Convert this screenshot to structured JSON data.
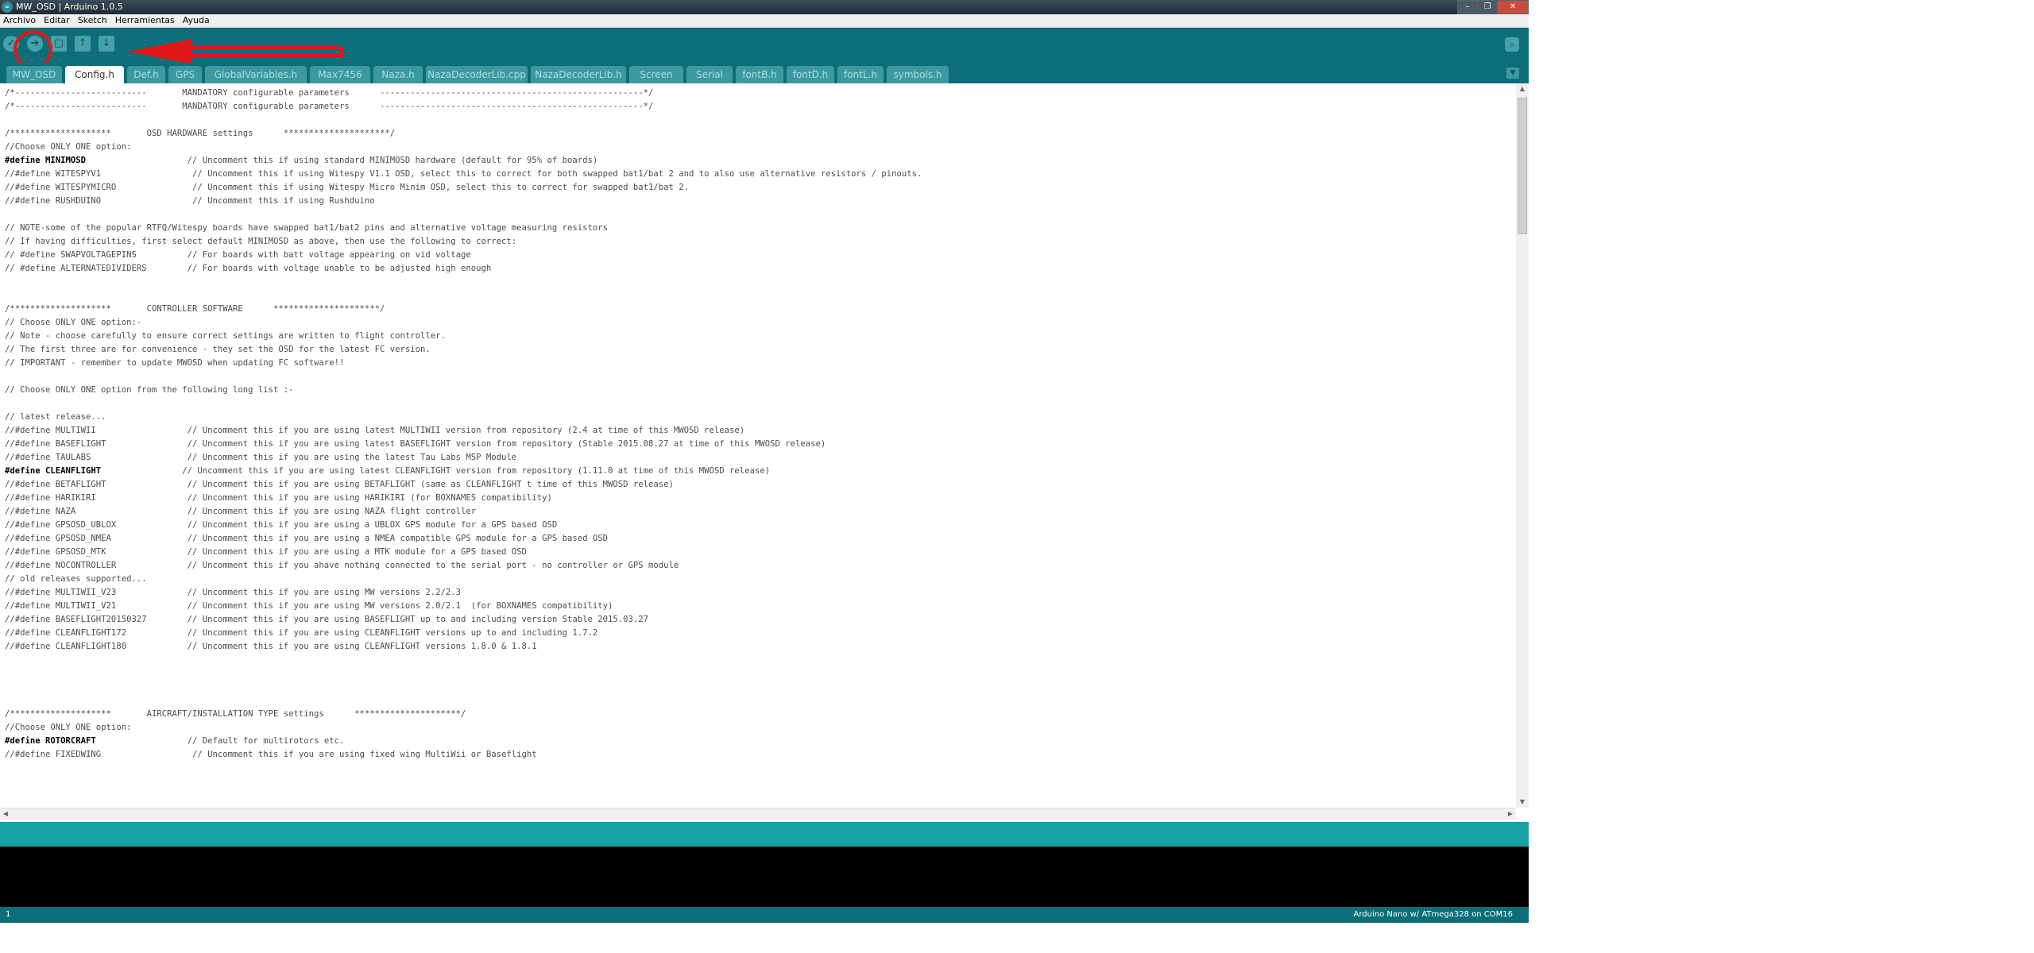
{
  "window": {
    "title": "MW_OSD | Arduino 1.0.5",
    "icon": "arduino-logo-icon",
    "controls": [
      "minimize-icon",
      "maximize-icon",
      "close-icon"
    ]
  },
  "menu": [
    "Archivo",
    "Editar",
    "Sketch",
    "Herramientas",
    "Ayuda"
  ],
  "toolbar": {
    "icons": [
      "verify-icon",
      "upload-icon",
      "new-icon",
      "open-icon",
      "save-icon"
    ],
    "serial_monitor_icon": "magnifier-icon",
    "annotation_color": "#e0181a"
  },
  "tabs": [
    "MW_OSD",
    "Config.h",
    "Def.h",
    "GPS",
    "GlobalVariables.h",
    "Max7456",
    "Naza.h",
    "NazaDecoderLib.cpp",
    "NazaDecoderLib.h",
    "Screen",
    "Serial",
    "fontB.h",
    "fontD.h",
    "fontL.h",
    "symbols.h"
  ],
  "active_tab": "Config.h",
  "code_lines": [
    "/*--------------------------       MANDATORY configurable parameters      ----------------------------------------------------*/",
    "/*--------------------------       MANDATORY configurable parameters      ----------------------------------------------------*/",
    "",
    "/********************       OSD HARDWARE settings      *********************/",
    "//Choose ONLY ONE option:",
    "#define MINIMOSD                    // Uncomment this if using standard MINIMOSD hardware (default for 95% of boards)",
    "//#define WITESPYV1                  // Uncomment this if using Witespy V1.1 OSD, select this to correct for both swapped bat1/bat 2 and to also use alternative resistors / pinouts.",
    "//#define WITESPYMICRO               // Uncomment this if using Witespy Micro Minim OSD, select this to correct for swapped bat1/bat 2.",
    "//#define RUSHDUINO                  // Uncomment this if using Rushduino",
    "",
    "// NOTE-some of the popular RTFQ/Witespy boards have swapped bat1/bat2 pins and alternative voltage measuring resistors",
    "// If having difficulties, first select default MINIMOSD as above, then use the following to correct:",
    "// #define SWAPVOLTAGEPINS          // For boards with batt voltage appearing on vid voltage",
    "// #define ALTERNATEDIVIDERS        // For boards with voltage unable to be adjusted high enough",
    "",
    "",
    "/********************       CONTROLLER SOFTWARE      *********************/",
    "// Choose ONLY ONE option:-",
    "// Note - choose carefully to ensure correct settings are written to flight controller.",
    "// The first three are for convenience - they set the OSD for the latest FC version.",
    "// IMPORTANT - remember to update MWOSD when updating FC software!!",
    "",
    "// Choose ONLY ONE option from the following long list :-",
    "",
    "// latest release...",
    "//#define MULTIWII                  // Uncomment this if you are using latest MULTIWII version from repository (2.4 at time of this MWOSD release)",
    "//#define BASEFLIGHT                // Uncomment this if you are using latest BASEFLIGHT version from repository (Stable 2015.08.27 at time of this MWOSD release)",
    "//#define TAULABS                   // Uncomment this if you are using the latest Tau Labs MSP Module",
    "#define CLEANFLIGHT                // Uncomment this if you are using latest CLEANFLIGHT version from repository (1.11.0 at time of this MWOSD release)",
    "//#define BETAFLIGHT                // Uncomment this if you are using BETAFLIGHT (same as CLEANFLIGHT t time of this MWOSD release)",
    "//#define HARIKIRI                  // Uncomment this if you are using HARIKIRI (for BOXNAMES compatibility)",
    "//#define NAZA                      // Uncomment this if you are using NAZA flight controller",
    "//#define GPSOSD_UBLOX              // Uncomment this if you are using a UBLOX GPS module for a GPS based OSD",
    "//#define GPSOSD_NMEA               // Uncomment this if you are using a NMEA compatible GPS module for a GPS based OSD",
    "//#define GPSOSD_MTK                // Uncomment this if you are using a MTK module for a GPS based OSD",
    "//#define NOCONTROLLER              // Uncomment this if you ahave nothing connected to the serial port - no controller or GPS module",
    "// old releases supported...",
    "//#define MULTIWII_V23              // Uncomment this if you are using MW versions 2.2/2.3",
    "//#define MULTIWII_V21              // Uncomment this if you are using MW versions 2.0/2.1  (for BOXNAMES compatibility)",
    "//#define BASEFLIGHT20150327        // Uncomment this if you are using BASEFLIGHT up to and including version Stable 2015.03.27",
    "//#define CLEANFLIGHT172            // Uncomment this if you are using CLEANFLIGHT versions up to and including 1.7.2",
    "//#define CLEANFLIGHT180            // Uncomment this if you are using CLEANFLIGHT versions 1.8.0 & 1.8.1",
    "",
    "",
    "",
    "",
    "/********************       AIRCRAFT/INSTALLATION TYPE settings      *********************/",
    "//Choose ONLY ONE option:",
    "#define ROTORCRAFT                  // Default for multirotors etc.",
    "//#define FIXEDWING                  // Uncomment this if you are using fixed wing MultiWii or Baseflight"
  ],
  "status": {
    "line_number": "1",
    "board": "Arduino Nano w/ ATmega328 on COM16"
  },
  "colors": {
    "teal_dark": "#0d6e79",
    "teal_light": "#17a1a5",
    "tab_inactive": "#3b9aa1",
    "console": "#000000"
  }
}
